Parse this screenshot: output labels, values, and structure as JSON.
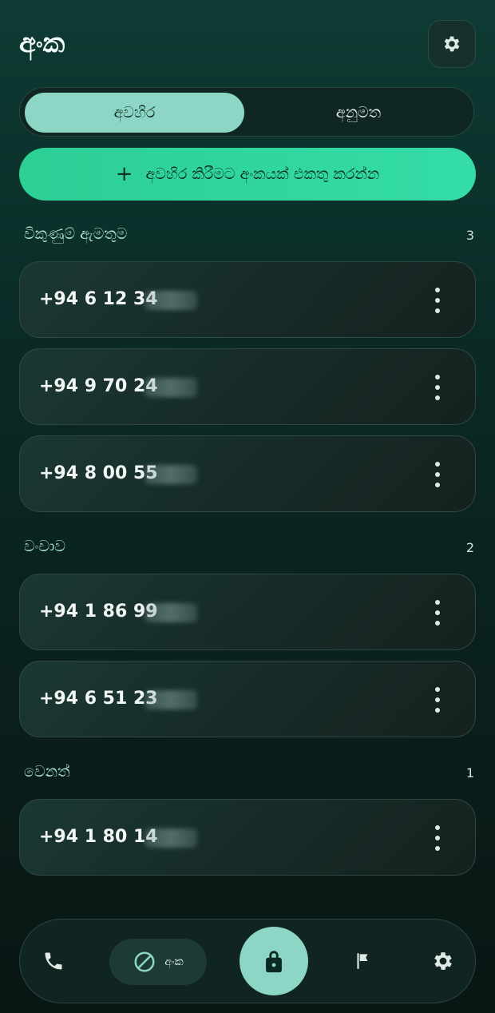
{
  "header": {
    "title": "අංක"
  },
  "tabs": [
    {
      "label": "අවහිර",
      "active": true
    },
    {
      "label": "අනුමත",
      "active": false
    }
  ],
  "add_button": {
    "label": "අවහිර කිරීමට අංකයක් එකතු කරන්න",
    "icon": "plus-icon"
  },
  "sections": [
    {
      "title": "විකුණුම් ඇමතුම",
      "count": "3",
      "numbers": [
        "+94 6 12 34",
        "+94 9 70 24",
        "+94 8 00 55"
      ]
    },
    {
      "title": "වංචාව",
      "count": "2",
      "numbers": [
        "+94 1 86 99",
        "+94 6 51 23"
      ]
    },
    {
      "title": "වෙනත්",
      "count": "1",
      "numbers": [
        "+94 1 80 14"
      ]
    }
  ],
  "nav": {
    "items": [
      "phone-icon",
      "block-icon",
      "lock-icon",
      "flag-icon",
      "gear-icon"
    ],
    "active_label": "අංක"
  },
  "colors": {
    "accent": "#8dd6c5",
    "button_green": "#2ccf94",
    "background": "#0b2a26"
  }
}
